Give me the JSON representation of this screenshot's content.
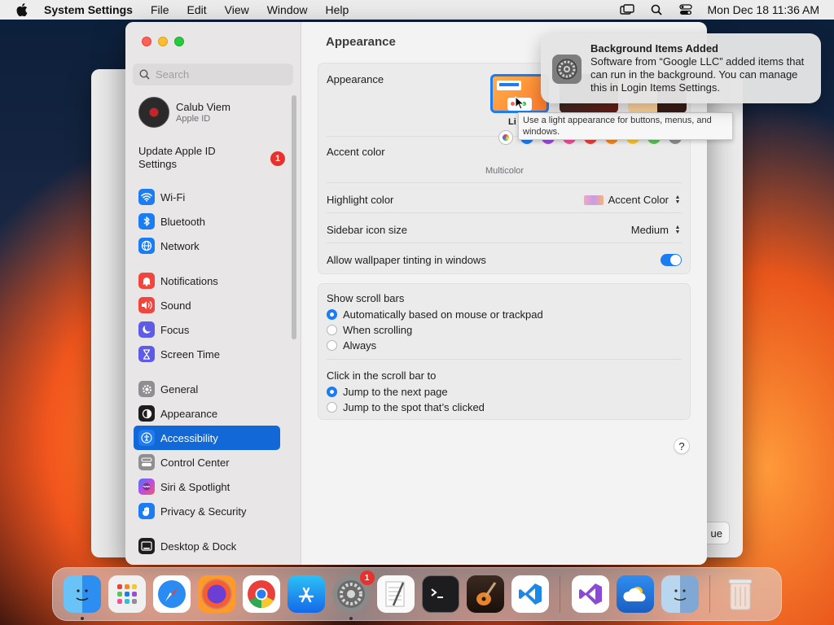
{
  "menubar": {
    "app_name": "System Settings",
    "items": [
      "File",
      "Edit",
      "View",
      "Window",
      "Help"
    ],
    "datetime": "Mon Dec 18  11:36 AM"
  },
  "background_window": {
    "button_label": "ue"
  },
  "sidebar": {
    "search_placeholder": "Search",
    "profile": {
      "name": "Calub Viem",
      "subtitle": "Apple ID"
    },
    "update": {
      "label": "Update Apple ID Settings",
      "badge": "1"
    },
    "items": [
      {
        "label": "Wi-Fi",
        "color": "#1c7cf2"
      },
      {
        "label": "Bluetooth",
        "color": "#1c7cf2"
      },
      {
        "label": "Network",
        "color": "#1c7cf2"
      },
      {
        "label": "Notifications",
        "color": "#f0463e"
      },
      {
        "label": "Sound",
        "color": "#f0463e"
      },
      {
        "label": "Focus",
        "color": "#5e5ce6"
      },
      {
        "label": "Screen Time",
        "color": "#5e5ce6"
      },
      {
        "label": "General",
        "color": "#8e8e93"
      },
      {
        "label": "Appearance",
        "color": "#1d1d1f"
      },
      {
        "label": "Accessibility",
        "color": "#1c7cf2"
      },
      {
        "label": "Control Center",
        "color": "#8e8e93"
      },
      {
        "label": "Siri & Spotlight",
        "color": "#a85ce0"
      },
      {
        "label": "Privacy & Security",
        "color": "#1c7cf2"
      },
      {
        "label": "Desktop & Dock",
        "color": "#1d1d1f"
      }
    ],
    "selected": "Accessibility"
  },
  "content": {
    "title": "Appearance",
    "appearance_label": "Appearance",
    "appearance_caption_light": "Li",
    "tooltip": "Use a light appearance for buttons, menus, and windows.",
    "accent_label": "Accent color",
    "accent_selected_caption": "Multicolor",
    "accent_colors": [
      "multicolor",
      "#1c7cf2",
      "#9b4bd8",
      "#f0509a",
      "#e9403b",
      "#f5871f",
      "#f7c72c",
      "#5ac35a",
      "#8e8e93"
    ],
    "highlight_label": "Highlight color",
    "highlight_value": "Accent Color",
    "sidebar_icon_label": "Sidebar icon size",
    "sidebar_icon_value": "Medium",
    "wallpaper_tinting_label": "Allow wallpaper tinting in windows",
    "wallpaper_tinting_on": true,
    "scroll_bars_label": "Show scroll bars",
    "scroll_bars_options": [
      "Automatically based on mouse or trackpad",
      "When scrolling",
      "Always"
    ],
    "scroll_bars_selected": 0,
    "click_scroll_label": "Click in the scroll bar to",
    "click_scroll_options": [
      "Jump to the next page",
      "Jump to the spot that’s clicked"
    ],
    "click_scroll_selected": 0,
    "help": "?"
  },
  "notification": {
    "title": "Background Items Added",
    "body": "Software from “Google LLC” added items that can run in the background. You can manage this in Login Items Settings."
  },
  "dock": {
    "apps": [
      "Finder",
      "Launchpad",
      "Safari",
      "Firefox",
      "Chrome",
      "App Store",
      "System Settings",
      "TextEdit",
      "Terminal",
      "GarageBand",
      "VS Code",
      "Visual Studio",
      "Weather",
      "Finder Alt",
      "Trash"
    ],
    "system_settings_badge": "1"
  }
}
